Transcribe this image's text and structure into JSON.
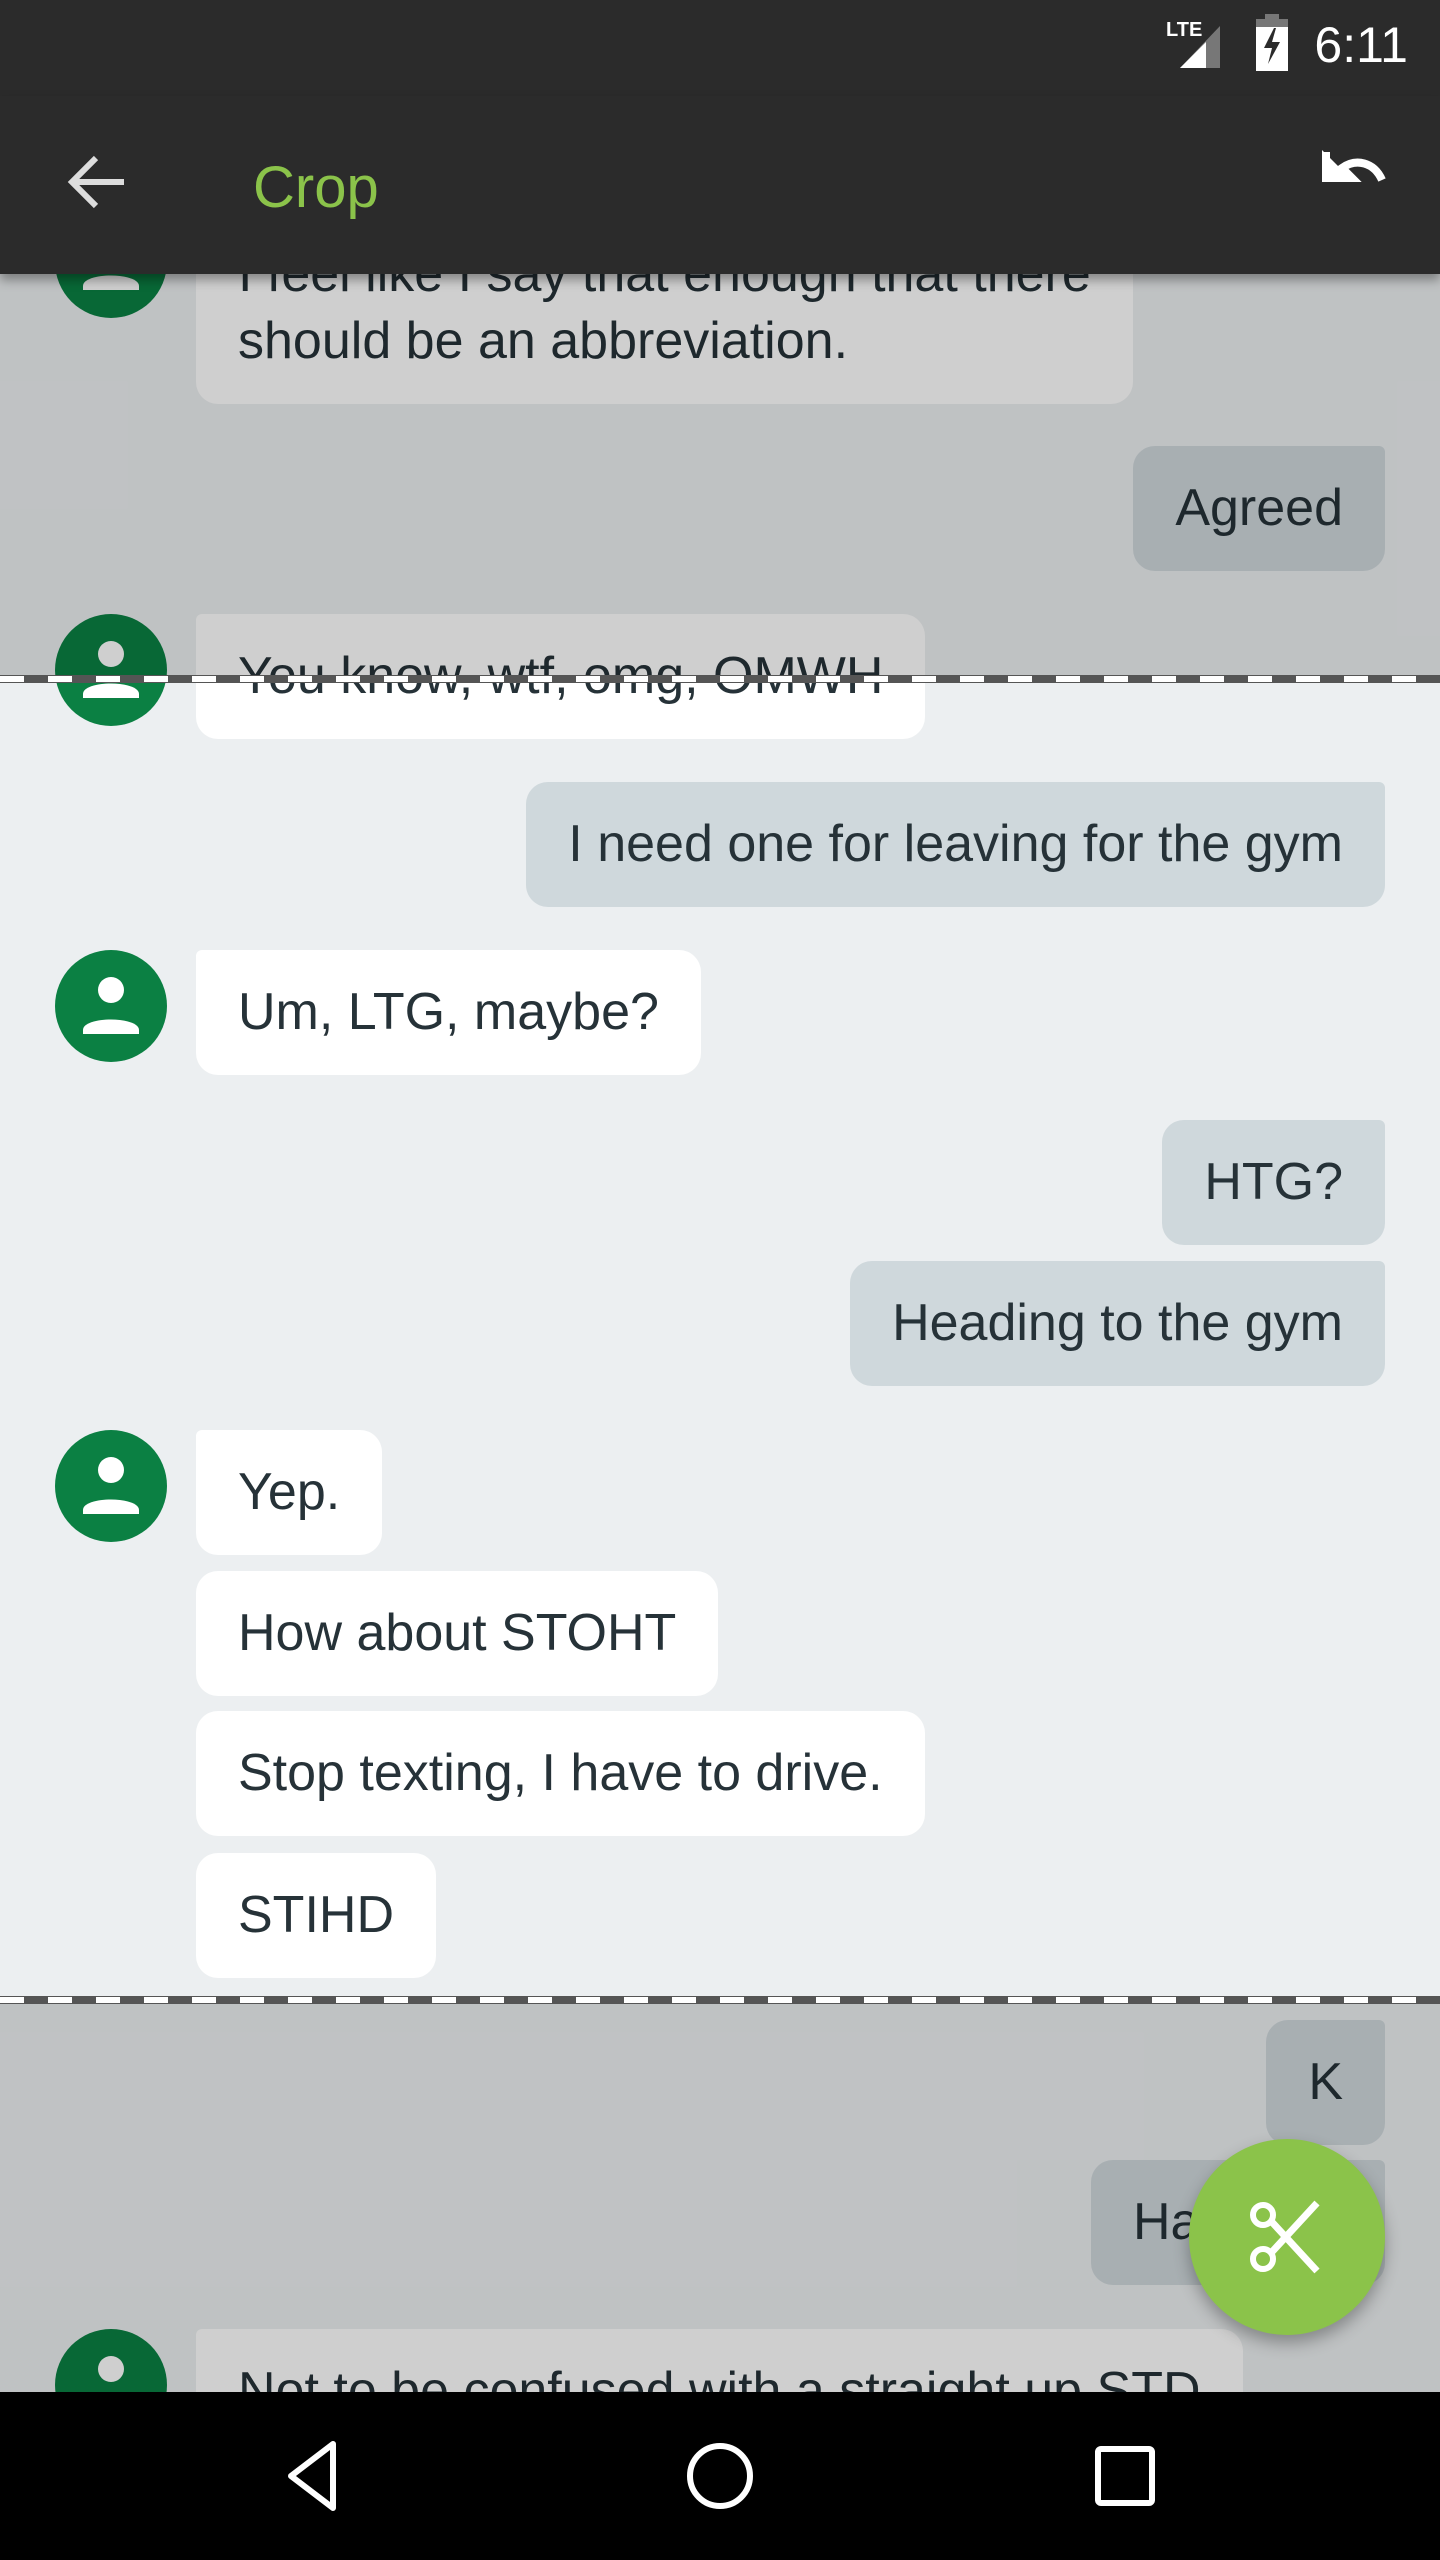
{
  "status_bar": {
    "time": "6:11",
    "network": "LTE",
    "icons": [
      "lte-signal-icon",
      "battery-charging-icon"
    ]
  },
  "toolbar": {
    "title": "Crop",
    "back_icon": "arrow-back-icon",
    "undo_icon": "undo-icon"
  },
  "colors": {
    "accent": "#8bc34a",
    "avatar": "#0b8043",
    "toolbar": "#2b2b2b",
    "sent_bubble": "#cfd8dc",
    "received_bubble": "#ffffff",
    "background": "#eceff1"
  },
  "messages": [
    {
      "dir": "received",
      "lines": [
        "I feel like I say that enough that there",
        "should be an abbreviation."
      ]
    },
    {
      "dir": "sent",
      "text": "Agreed"
    },
    {
      "dir": "received",
      "text": "You know, wtf, omg, OMWH"
    },
    {
      "dir": "sent",
      "text": "I need one for leaving for the gym"
    },
    {
      "dir": "received",
      "text": "Um, LTG, maybe?"
    },
    {
      "dir": "sent",
      "text": "HTG?"
    },
    {
      "dir": "sent",
      "text": "Heading to the gym"
    },
    {
      "dir": "received",
      "text": "Yep."
    },
    {
      "dir": "received",
      "text": "How about STOHT"
    },
    {
      "dir": "received",
      "text": "Stop texting, I have to drive."
    },
    {
      "dir": "received",
      "text": "STIHD"
    },
    {
      "dir": "sent",
      "text": "K"
    },
    {
      "dir": "sent",
      "text": "Ha"
    },
    {
      "dir": "received",
      "text": "Not to be confused with a straight up STD"
    }
  ],
  "fab": {
    "icon": "scissors-icon",
    "action": "crop"
  },
  "nav_bar": {
    "buttons": [
      "back",
      "home",
      "recents"
    ]
  }
}
